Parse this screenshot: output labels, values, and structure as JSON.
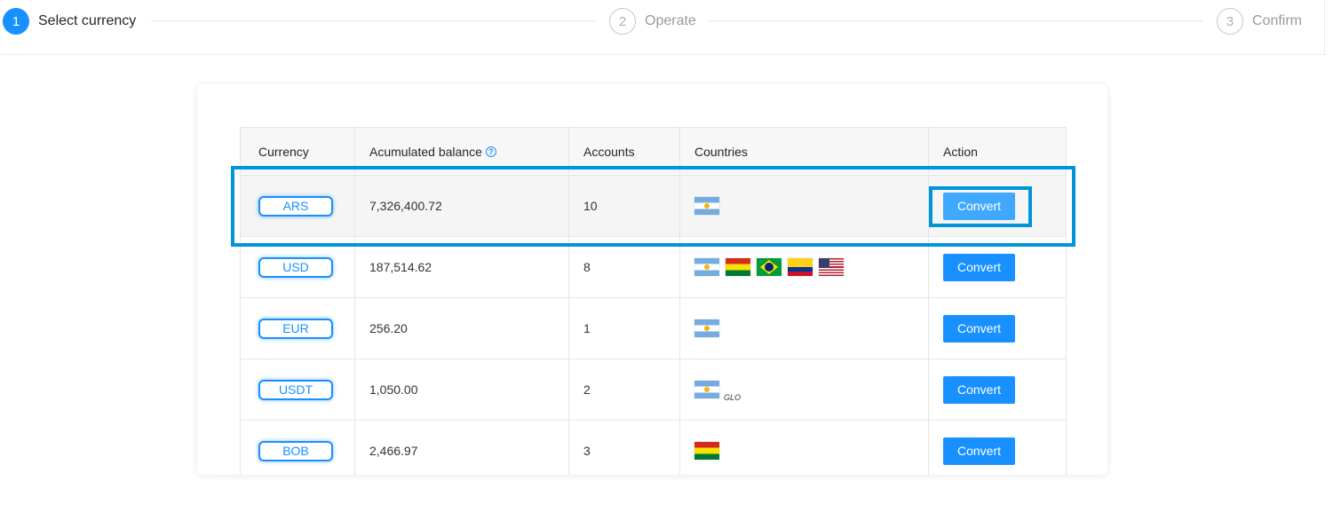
{
  "stepper": {
    "steps": [
      {
        "number": "1",
        "label": "Select currency",
        "state": "active"
      },
      {
        "number": "2",
        "label": "Operate",
        "state": "inactive"
      },
      {
        "number": "3",
        "label": "Confirm",
        "state": "inactive"
      }
    ]
  },
  "table": {
    "headers": {
      "currency": "Currency",
      "balance": "Acumulated balance",
      "accounts": "Accounts",
      "countries": "Countries",
      "action": "Action"
    },
    "help_icon": "?",
    "rows": [
      {
        "currency": "ARS",
        "balance": "7,326,400.72",
        "accounts": "10",
        "flags": [
          "argentina-flag"
        ],
        "action": "Convert"
      },
      {
        "currency": "USD",
        "balance": "187,514.62",
        "accounts": "8",
        "flags": [
          "argentina-flag",
          "bolivia-flag",
          "brazil-flag",
          "colombia-flag",
          "usa-flag"
        ],
        "action": "Convert"
      },
      {
        "currency": "EUR",
        "balance": "256.20",
        "accounts": "1",
        "flags": [
          "argentina-flag"
        ],
        "action": "Convert"
      },
      {
        "currency": "USDT",
        "balance": "1,050.00",
        "accounts": "2",
        "flags": [
          "argentina-flag"
        ],
        "glo": "GLO",
        "action": "Convert"
      },
      {
        "currency": "BOB",
        "balance": "2,466.97",
        "accounts": "3",
        "flags": [
          "bolivia-flag"
        ],
        "action": "Convert"
      }
    ]
  },
  "colors": {
    "accent": "#1890ff",
    "highlight_box": "#0095da"
  }
}
